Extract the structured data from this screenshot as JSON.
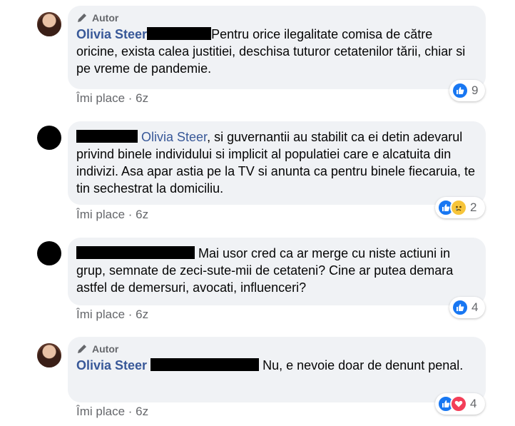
{
  "comments": [
    {
      "badge": "Autor",
      "name": "Olivia Steer",
      "text": "Pentru orice ilegalitate comisa de către oricine, exista calea justitiei, deschisa tuturor cetatenilor tării, chiar si pe vreme de pandemie.",
      "like_label": "Îmi place",
      "separator": "·",
      "time": "6z",
      "reactions": [
        "like"
      ],
      "reaction_count": "9"
    },
    {
      "mention": "Olivia Steer",
      "text": ", si guvernantii au stabilit ca ei detin adevarul privind binele individului si implicit al populatiei care e alcatuita din indivizi. Asa apar astia pe la TV si anunta ca pentru binele fiecaruia, te tin sechestrat la domiciliu.",
      "like_label": "Îmi place",
      "separator": "·",
      "time": "6z",
      "reactions": [
        "like",
        "sad"
      ],
      "reaction_count": "2"
    },
    {
      "text": "Mai usor cred ca ar merge cu niste actiuni in grup, semnate de zeci-sute-mii de cetateni? Cine ar putea demara astfel de demersuri, avocati, influenceri?",
      "like_label": "Îmi place",
      "separator": "·",
      "time": "6z",
      "reactions": [
        "like"
      ],
      "reaction_count": "4"
    },
    {
      "badge": "Autor",
      "name": "Olivia Steer",
      "text": "Nu, e nevoie doar de denunt penal.",
      "like_label": "Îmi place",
      "separator": "·",
      "time": "6z",
      "reactions": [
        "like",
        "love"
      ],
      "reaction_count": "4"
    }
  ],
  "colors": {
    "name": "#385898",
    "meta": "#65676b",
    "bubble": "#f0f2f5",
    "like": "#1877f2",
    "love": "#f33e58",
    "sad": "#f7c53a"
  },
  "icons": {
    "badge": "pencil-icon",
    "like": "thumbs-up-icon",
    "love": "heart-icon",
    "sad": "sad-face-icon"
  }
}
